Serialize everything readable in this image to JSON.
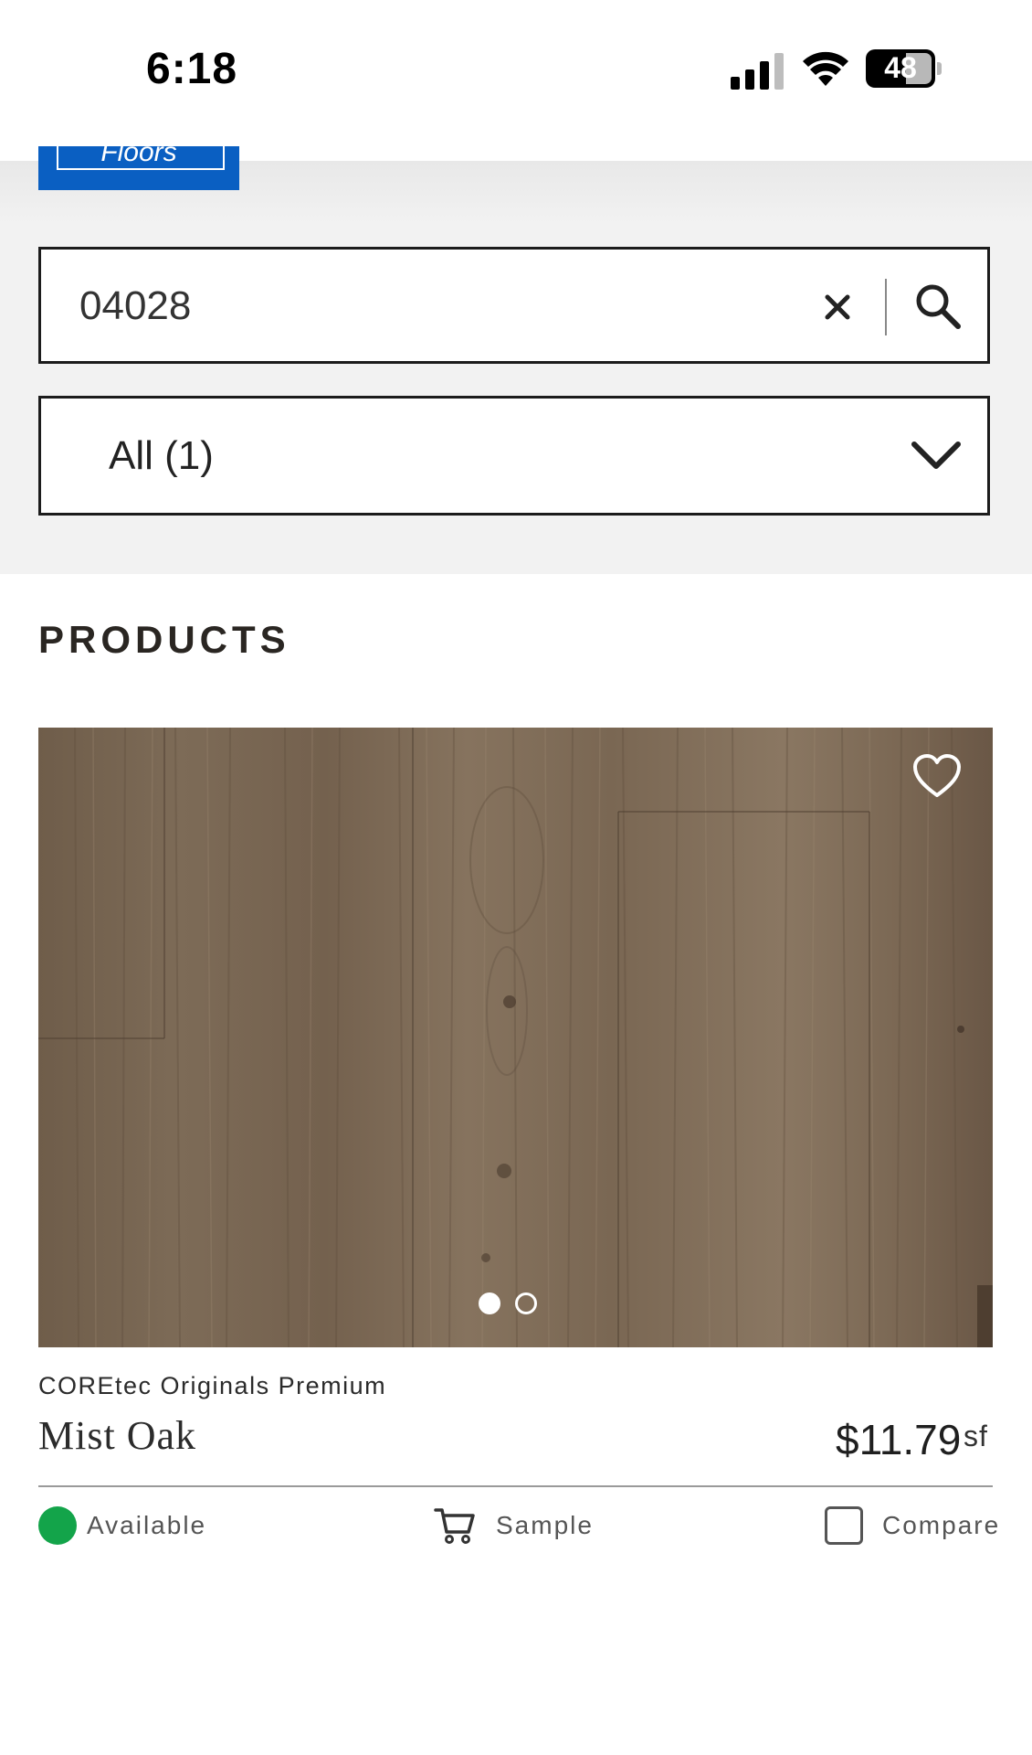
{
  "status_bar": {
    "time": "6:18",
    "battery": "48"
  },
  "header": {
    "logo_text": "Floors"
  },
  "search": {
    "value": "04028",
    "placeholder": ""
  },
  "filter": {
    "selected": "All (1)"
  },
  "products": {
    "heading": "PRODUCTS",
    "items": [
      {
        "brand": "COREtec Originals Premium",
        "name": "Mist Oak",
        "price": "$11.79",
        "unit": "sf",
        "availability": "Available",
        "sample_label": "Sample",
        "compare_label": "Compare",
        "image_count": 2,
        "active_image": 1,
        "availability_color": "#13a44a"
      }
    ]
  },
  "colors": {
    "brand_blue": "#0a5fc2",
    "panel_bg": "#f2f2f2",
    "border": "#1c1c1c"
  },
  "icons": [
    "signal-icon",
    "wifi-icon",
    "battery-icon",
    "clear-icon",
    "search-icon",
    "chevron-down-icon",
    "heart-icon",
    "cart-icon",
    "checkbox-icon"
  ]
}
